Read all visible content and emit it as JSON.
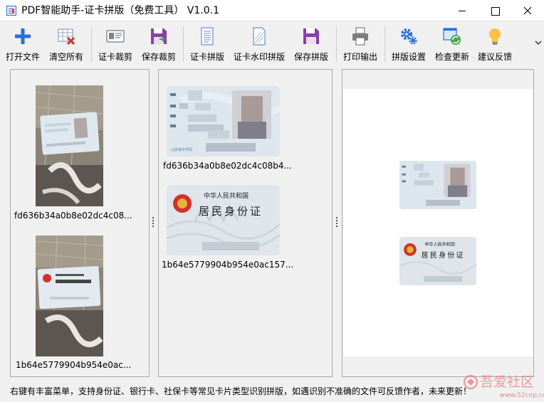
{
  "window": {
    "title": "PDF智能助手-证卡拼版（免费工具） V1.0.1"
  },
  "toolbar": {
    "open_files": "打开文件",
    "clear_all": "清空所有",
    "card_crop": "证卡裁剪",
    "save_crop": "保存裁剪",
    "card_layout": "证卡拼版",
    "card_watermark_layout": "证卡水印拼版",
    "save_layout": "保存拼版",
    "print_output": "打印输出",
    "layout_settings": "拼版设置",
    "check_update": "检查更新",
    "feedback": "建议反馈"
  },
  "left_panel": {
    "items": [
      {
        "caption": "fd636b34a0b8e02dc4c08..."
      },
      {
        "caption": "1b64e5779904b954e0ac..."
      }
    ]
  },
  "middle_panel": {
    "items": [
      {
        "caption": "fd636b34a0b8e02dc4c08b4..."
      },
      {
        "caption": "1b64e5779904b954e0ac157..."
      }
    ]
  },
  "card": {
    "back_line1": "中华人民共和国",
    "back_line2": "居民身份证",
    "front_id_label": "公民身份号码"
  },
  "status": {
    "text": "右键有丰富菜单，支持身份证、银行卡、社保卡等常见卡片类型识别拼版，如遇识别不准确的文件可反馈作者，未来更新！"
  },
  "watermark": {
    "text": "吾爱社区",
    "sub": "www.52cnp.com"
  },
  "colors": {
    "accent_blue": "#2a6fd6",
    "save_purple": "#8a3fa8",
    "flag_red": "#d2312b",
    "bulb_yellow": "#f6c342"
  }
}
